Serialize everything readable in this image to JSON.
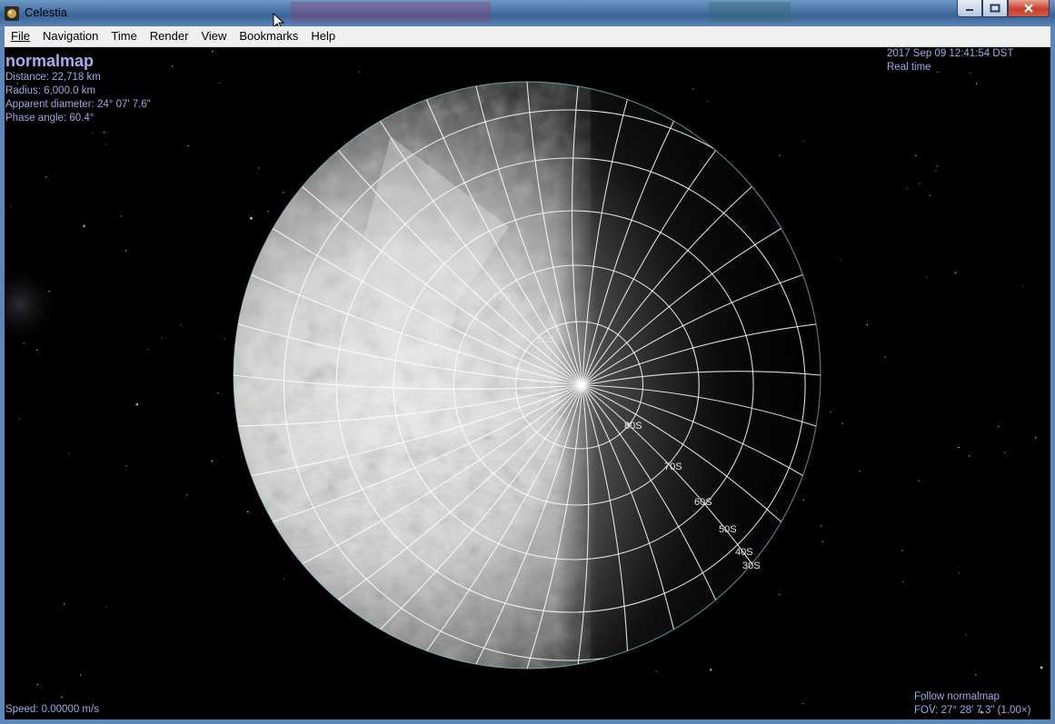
{
  "window": {
    "title": "Celestia"
  },
  "menu": [
    {
      "label": "File",
      "key": "File"
    },
    {
      "label": "Navigation",
      "key": "Navigation"
    },
    {
      "label": "Time",
      "key": "Time"
    },
    {
      "label": "Render",
      "key": "Render"
    },
    {
      "label": "View",
      "key": "View"
    },
    {
      "label": "Bookmarks",
      "key": "Bookmarks"
    },
    {
      "label": "Help",
      "key": "Help"
    }
  ],
  "hud": {
    "target_name": "normalmap",
    "distance": "Distance: 22,718 km",
    "radius": "Radius: 6,000.0 km",
    "apparent_diameter": "Apparent diameter: 24° 07' 7.6\"",
    "phase_angle": "Phase angle: 60.4°",
    "datetime": "2017 Sep 09 12:41:54 DST",
    "time_mode": "Real time",
    "speed": "Speed: 0.00000 m/s",
    "follow": "Follow normalmap",
    "fov": "FOV: 27° 28' 7.3\" (1.00×)"
  },
  "grid_labels": [
    "70S",
    "80S",
    "80S",
    "70S",
    "60S",
    "50S",
    "40S",
    "30S"
  ],
  "colors": {
    "hud_text": "#a2a6e6",
    "title_bar": "#4f79ab",
    "menu_bg": "#f0f0f0"
  }
}
